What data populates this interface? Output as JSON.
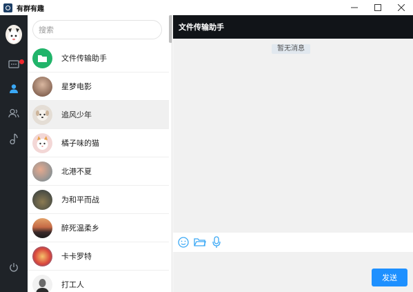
{
  "window": {
    "title": "有群有趣",
    "accent": "#1e90ff"
  },
  "rail": {
    "icons": [
      "chat-icon",
      "contacts-icon",
      "group-icon",
      "music-icon",
      "power-icon"
    ],
    "unread_dot_color": "#f0282e"
  },
  "search": {
    "placeholder": "搜索"
  },
  "contacts": [
    {
      "name": "文件传输助手",
      "avatar": "folder-avatar",
      "active": false
    },
    {
      "name": "星梦电影",
      "avatar": "photo-avatar",
      "active": false
    },
    {
      "name": "追风少年",
      "avatar": "dog-avatar",
      "active": true
    },
    {
      "name": "橘子味的猫",
      "avatar": "cat-avatar",
      "active": false
    },
    {
      "name": "北港不夏",
      "avatar": "photo-avatar",
      "active": false
    },
    {
      "name": "为和平而战",
      "avatar": "photo-avatar",
      "active": false
    },
    {
      "name": "醉死温柔乡",
      "avatar": "sunset-avatar",
      "active": false
    },
    {
      "name": "卡卡罗特",
      "avatar": "photo-avatar",
      "active": false
    },
    {
      "name": "打工人",
      "avatar": "person-avatar",
      "active": false
    }
  ],
  "chat": {
    "title": "文件传输助手",
    "empty_text": "暂无消息",
    "tools": [
      "emoji-icon",
      "folder-icon",
      "microphone-icon"
    ],
    "send_label": "发送"
  }
}
